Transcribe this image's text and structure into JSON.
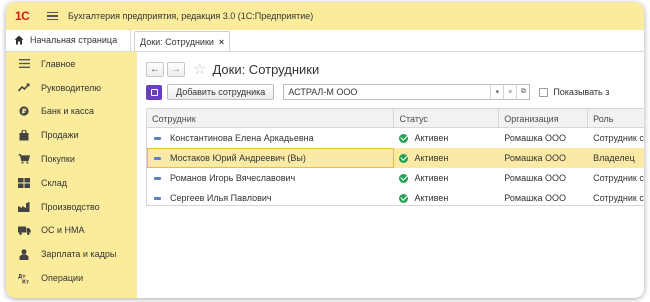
{
  "app": {
    "title": "Бухгалтерия предприятия, редакция 3.0  (1С:Предприятие)",
    "logo_text": "1С"
  },
  "tabs": {
    "home_label": "Начальная страница",
    "doc_tab_label": "Доки: Сотрудники",
    "close_symbol": "×"
  },
  "sidebar": {
    "items": [
      {
        "label": "Главное",
        "icon": "menu-lines-icon"
      },
      {
        "label": "Руководителю",
        "icon": "trend-arrow-icon"
      },
      {
        "label": "Банк и касса",
        "icon": "coin-icon"
      },
      {
        "label": "Продажи",
        "icon": "shopping-bag-icon"
      },
      {
        "label": "Покупки",
        "icon": "shopping-cart-icon"
      },
      {
        "label": "Склад",
        "icon": "warehouse-grid-icon"
      },
      {
        "label": "Производство",
        "icon": "factory-icon"
      },
      {
        "label": "ОС и НМА",
        "icon": "truck-icon"
      },
      {
        "label": "Зарплата и кадры",
        "icon": "person-icon"
      },
      {
        "label": "Операции",
        "icon": "dt-kt-icon"
      }
    ]
  },
  "main": {
    "back_symbol": "←",
    "forward_symbol": "→",
    "star_symbol": "☆",
    "page_title": "Доки: Сотрудники",
    "add_button_label": "Добавить сотрудника",
    "org_field_value": "АСТРАЛ-М ООО",
    "dropdown_symbol": "▾",
    "clear_symbol": "×",
    "open_symbol": "⧉",
    "show_checkbox_label": "Показывать з"
  },
  "table": {
    "columns": [
      "Сотрудник",
      "Статус",
      "Организация",
      "Роль"
    ],
    "rows": [
      {
        "name": "Константинова Елена Аркадьевна",
        "status": "Активен",
        "org": "Ромашка ООО",
        "role": "Сотрудник с",
        "selected": false
      },
      {
        "name": "Мостаков Юрий Андреевич (Вы)",
        "status": "Активен",
        "org": "Ромашка ООО",
        "role": "Владелец",
        "selected": true
      },
      {
        "name": "Романов Игорь Вячеславович",
        "status": "Активен",
        "org": "Ромашка ООО",
        "role": "Сотрудник с",
        "selected": false
      },
      {
        "name": "Сергеев Илья Павлович",
        "status": "Активен",
        "org": "Ромашка ООО",
        "role": "Сотрудник с",
        "selected": false
      }
    ]
  },
  "colors": {
    "sidebar_bg": "#fbec9c",
    "accent_red": "#d6191b",
    "status_green": "#27a153",
    "selection_bg": "#fbeaa6",
    "purple_button": "#6a3fbf"
  }
}
